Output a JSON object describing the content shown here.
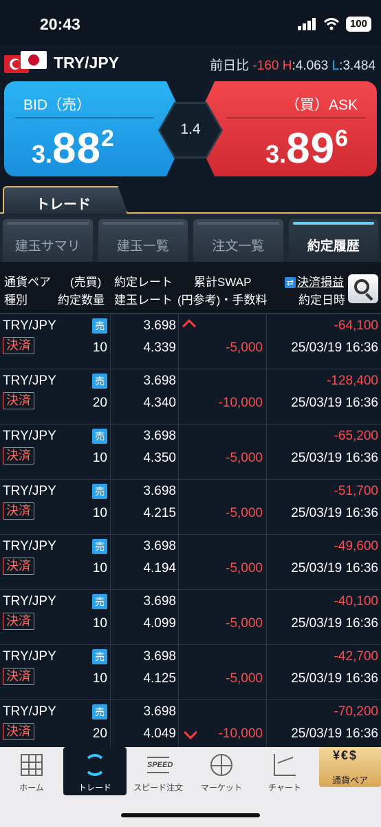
{
  "status": {
    "time": "20:43",
    "battery": "100"
  },
  "pair": {
    "name": "TRY/JPY",
    "change_label": "前日比",
    "change": "-160",
    "high_label": "H",
    "high": "4.063",
    "low_label": "L",
    "low": "3.484"
  },
  "bid": {
    "label": "BID（売）",
    "prefix": "3.",
    "main": "88",
    "sup": "2"
  },
  "ask": {
    "label": "（買）ASK",
    "prefix": "3.",
    "main": "89",
    "sup": "6"
  },
  "spread": "1.4",
  "trade_tab": "トレード",
  "subtabs": [
    "建玉サマリ",
    "建玉一覧",
    "注文一覧",
    "約定履歴"
  ],
  "columns": {
    "pair": "通貨ペア",
    "side": "(売買)",
    "rate": "約定レート",
    "swap": "累計SWAP",
    "pnl": "決済損益",
    "kind": "種別",
    "qty": "約定数量",
    "open_rate": "建玉レート",
    "fee": "(円参考)・手数料",
    "datetime": "約定日時"
  },
  "rows": [
    {
      "pair": "TRY/JPY",
      "side": "売",
      "kind": "決済",
      "qty": "10",
      "rate": "3.698",
      "open_rate": "4.339",
      "fee": "-5,000",
      "pnl": "-64,100",
      "datetime": "25/03/19 16:36"
    },
    {
      "pair": "TRY/JPY",
      "side": "売",
      "kind": "決済",
      "qty": "20",
      "rate": "3.698",
      "open_rate": "4.340",
      "fee": "-10,000",
      "pnl": "-128,400",
      "datetime": "25/03/19 16:36"
    },
    {
      "pair": "TRY/JPY",
      "side": "売",
      "kind": "決済",
      "qty": "10",
      "rate": "3.698",
      "open_rate": "4.350",
      "fee": "-5,000",
      "pnl": "-65,200",
      "datetime": "25/03/19 16:36"
    },
    {
      "pair": "TRY/JPY",
      "side": "売",
      "kind": "決済",
      "qty": "10",
      "rate": "3.698",
      "open_rate": "4.215",
      "fee": "-5,000",
      "pnl": "-51,700",
      "datetime": "25/03/19 16:36"
    },
    {
      "pair": "TRY/JPY",
      "side": "売",
      "kind": "決済",
      "qty": "10",
      "rate": "3.698",
      "open_rate": "4.194",
      "fee": "-5,000",
      "pnl": "-49,600",
      "datetime": "25/03/19 16:36"
    },
    {
      "pair": "TRY/JPY",
      "side": "売",
      "kind": "決済",
      "qty": "10",
      "rate": "3.698",
      "open_rate": "4.099",
      "fee": "-5,000",
      "pnl": "-40,100",
      "datetime": "25/03/19 16:36"
    },
    {
      "pair": "TRY/JPY",
      "side": "売",
      "kind": "決済",
      "qty": "10",
      "rate": "3.698",
      "open_rate": "4.125",
      "fee": "-5,000",
      "pnl": "-42,700",
      "datetime": "25/03/19 16:36"
    },
    {
      "pair": "TRY/JPY",
      "side": "売",
      "kind": "決済",
      "qty": "20",
      "rate": "3.698",
      "open_rate": "4.049",
      "fee": "-10,000",
      "pnl": "-70,200",
      "datetime": "25/03/19 16:36"
    }
  ],
  "nav": [
    {
      "label": "ホーム",
      "icon": "grid-icon"
    },
    {
      "label": "トレード",
      "icon": "cycle-icon"
    },
    {
      "label": "スピード注文",
      "icon": "speed-icon",
      "icon_text": "SPEED"
    },
    {
      "label": "マーケット",
      "icon": "globe-icon"
    },
    {
      "label": "チャート",
      "icon": "chart-icon"
    },
    {
      "label": "通貨ペア",
      "icon": "currency-icon",
      "icon_text": "¥€$"
    }
  ],
  "colors": {
    "bid": "#2ab3f4",
    "ask": "#f2474c",
    "accent": "#e0b76a",
    "negative": "#ff4b4b"
  }
}
